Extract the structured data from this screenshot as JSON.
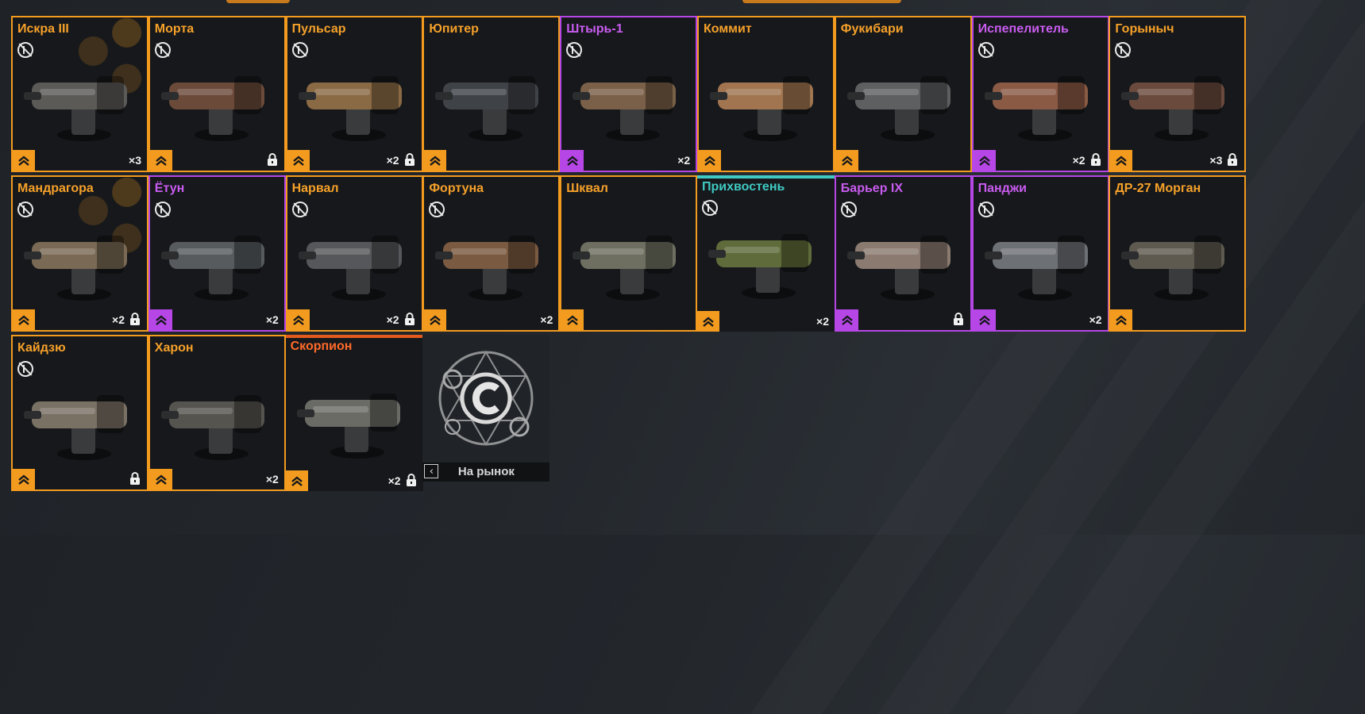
{
  "accent_colors": {
    "orange": "#f29b1e",
    "purple": "#b646e6",
    "cyan": "#3fc9c2",
    "red": "#e35b1c"
  },
  "items": [
    {
      "name": "Искра III",
      "rarity": "orange",
      "not_craftable_icon": true,
      "count": "×3",
      "locked": false,
      "hex_bg": true
    },
    {
      "name": "Морта",
      "rarity": "orange",
      "not_craftable_icon": true,
      "count": "",
      "locked": true
    },
    {
      "name": "Пульсар",
      "rarity": "orange",
      "not_craftable_icon": true,
      "count": "×2",
      "locked": true
    },
    {
      "name": "Юпитер",
      "rarity": "orange",
      "not_craftable_icon": false,
      "count": "",
      "locked": false
    },
    {
      "name": "Штырь-1",
      "rarity": "purple",
      "not_craftable_icon": true,
      "count": "×2",
      "locked": false
    },
    {
      "name": "Коммит",
      "rarity": "orange",
      "not_craftable_icon": false,
      "count": "",
      "locked": false
    },
    {
      "name": "Фукибари",
      "rarity": "orange",
      "not_craftable_icon": false,
      "count": "",
      "locked": false
    },
    {
      "name": "Испепелитель",
      "rarity": "purple",
      "not_craftable_icon": true,
      "count": "×2",
      "locked": true
    },
    {
      "name": "Горыныч",
      "rarity": "orange",
      "not_craftable_icon": true,
      "count": "×3",
      "locked": true
    },
    {
      "name": "Мандрагора",
      "rarity": "orange",
      "not_craftable_icon": true,
      "count": "×2",
      "locked": true,
      "hex_bg": true
    },
    {
      "name": "Ётун",
      "rarity": "purple",
      "not_craftable_icon": true,
      "count": "×2",
      "locked": false
    },
    {
      "name": "Нарвал",
      "rarity": "orange",
      "not_craftable_icon": true,
      "count": "×2",
      "locked": true
    },
    {
      "name": "Фортуна",
      "rarity": "orange",
      "not_craftable_icon": true,
      "count": "×2",
      "locked": false
    },
    {
      "name": "Шквал",
      "rarity": "orange",
      "not_craftable_icon": false,
      "count": "",
      "locked": false
    },
    {
      "name": "Прихвостень",
      "rarity": "cyan",
      "not_craftable_icon": true,
      "count": "×2",
      "locked": false
    },
    {
      "name": "Барьер IX",
      "rarity": "purple",
      "not_craftable_icon": true,
      "count": "",
      "locked": true
    },
    {
      "name": "Панджи",
      "rarity": "purple",
      "not_craftable_icon": true,
      "count": "×2",
      "locked": false
    },
    {
      "name": "ДР-27 Морган",
      "rarity": "orange",
      "not_craftable_icon": false,
      "count": "",
      "locked": false
    },
    {
      "name": "Кайдзю",
      "rarity": "orange",
      "not_craftable_icon": true,
      "count": "",
      "locked": true
    },
    {
      "name": "Харон",
      "rarity": "orange",
      "not_craftable_icon": false,
      "count": "×2",
      "locked": false
    },
    {
      "name": "Скорпион",
      "rarity": "red",
      "not_craftable_icon": false,
      "count": "×2",
      "locked": true
    }
  ],
  "market": {
    "label": "На рынок",
    "icon": "chevron-left-icon",
    "emblem_icon": "currency-c-emblem-icon"
  },
  "icons": {
    "rank": "chevron-up-double-icon",
    "lock": "lock-icon",
    "not_craftable": "no-craft-icon"
  }
}
